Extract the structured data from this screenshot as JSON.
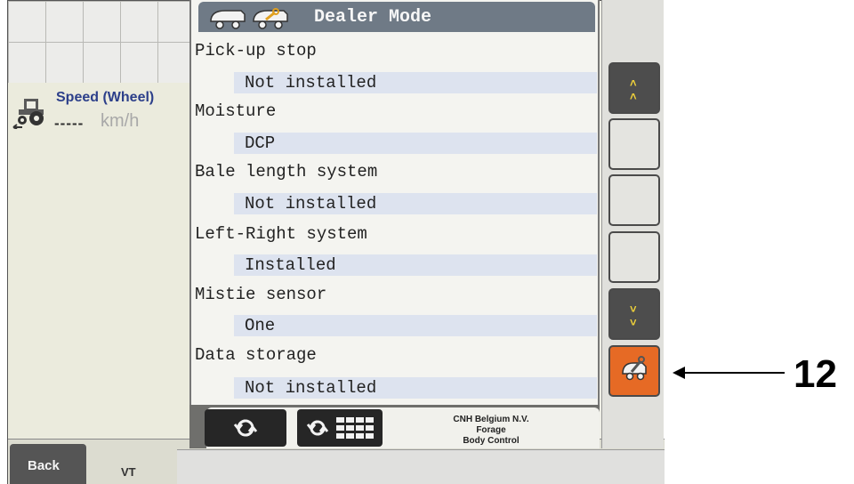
{
  "header": {
    "title": "Dealer Mode",
    "icons": [
      "baler-icon",
      "baler-wrench-icon"
    ]
  },
  "speed": {
    "title": "Speed (Wheel)",
    "value": "-----",
    "unit": "km/h",
    "icon": "tractor-icon"
  },
  "settings": [
    {
      "label": "Pick-up stop",
      "value": "Not installed"
    },
    {
      "label": "Moisture",
      "value": "DCP"
    },
    {
      "label": "Bale length system",
      "value": "Not installed"
    },
    {
      "label": "Left-Right system",
      "value": "Installed"
    },
    {
      "label": "Mistie sensor",
      "value": "One"
    },
    {
      "label": "Data storage",
      "value": "Not installed"
    }
  ],
  "bottom": {
    "back_label": "Back",
    "vt_label": "VT"
  },
  "tabs": {
    "refresh_icon": "refresh-icon",
    "refresh_grid_icon": "refresh-grid-icon"
  },
  "company": {
    "line1": "CNH Belgium N.V.",
    "line2": "Forage",
    "line3": "Body Control"
  },
  "softkeys": {
    "page_up_icon": "double-chevron-up-icon",
    "page_down_icon": "double-chevron-down-icon",
    "dealer_icon": "baler-wrench-icon"
  },
  "annotation": {
    "callout": "12"
  },
  "colors": {
    "title_bar": "#6f7a86",
    "value_highlight": "#dde3ef",
    "dealer_key": "#e66a25",
    "speed_title": "#2c3f8a"
  }
}
